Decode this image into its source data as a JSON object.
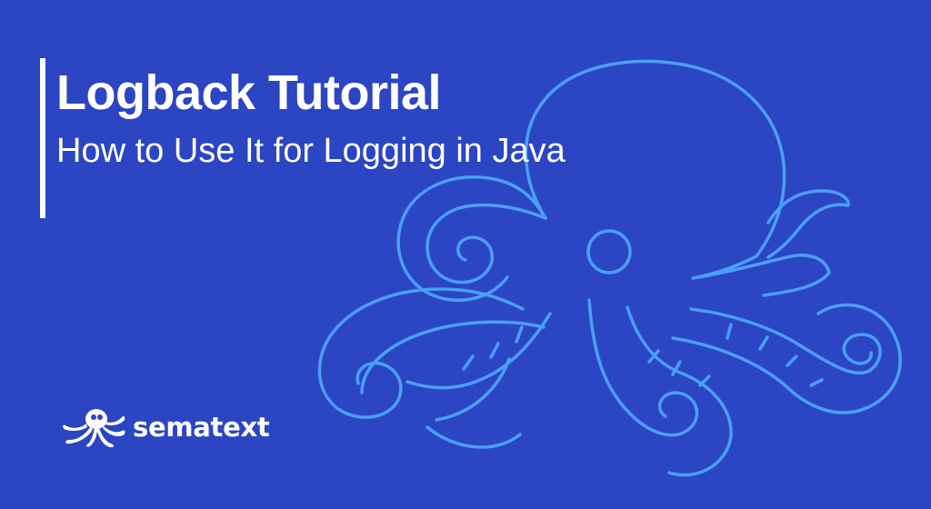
{
  "colors": {
    "background": "#2c45c2",
    "accent_line": "#ffffff",
    "octopus_outline": "#4a9ff5",
    "text": "#ffffff"
  },
  "hero": {
    "title": "Logback Tutorial",
    "subtitle": "How to Use It for Logging in Java"
  },
  "brand": {
    "name": "sematext",
    "logo_icon": "octopus-logo-icon"
  },
  "illustration": {
    "icon": "octopus-outline-icon"
  }
}
